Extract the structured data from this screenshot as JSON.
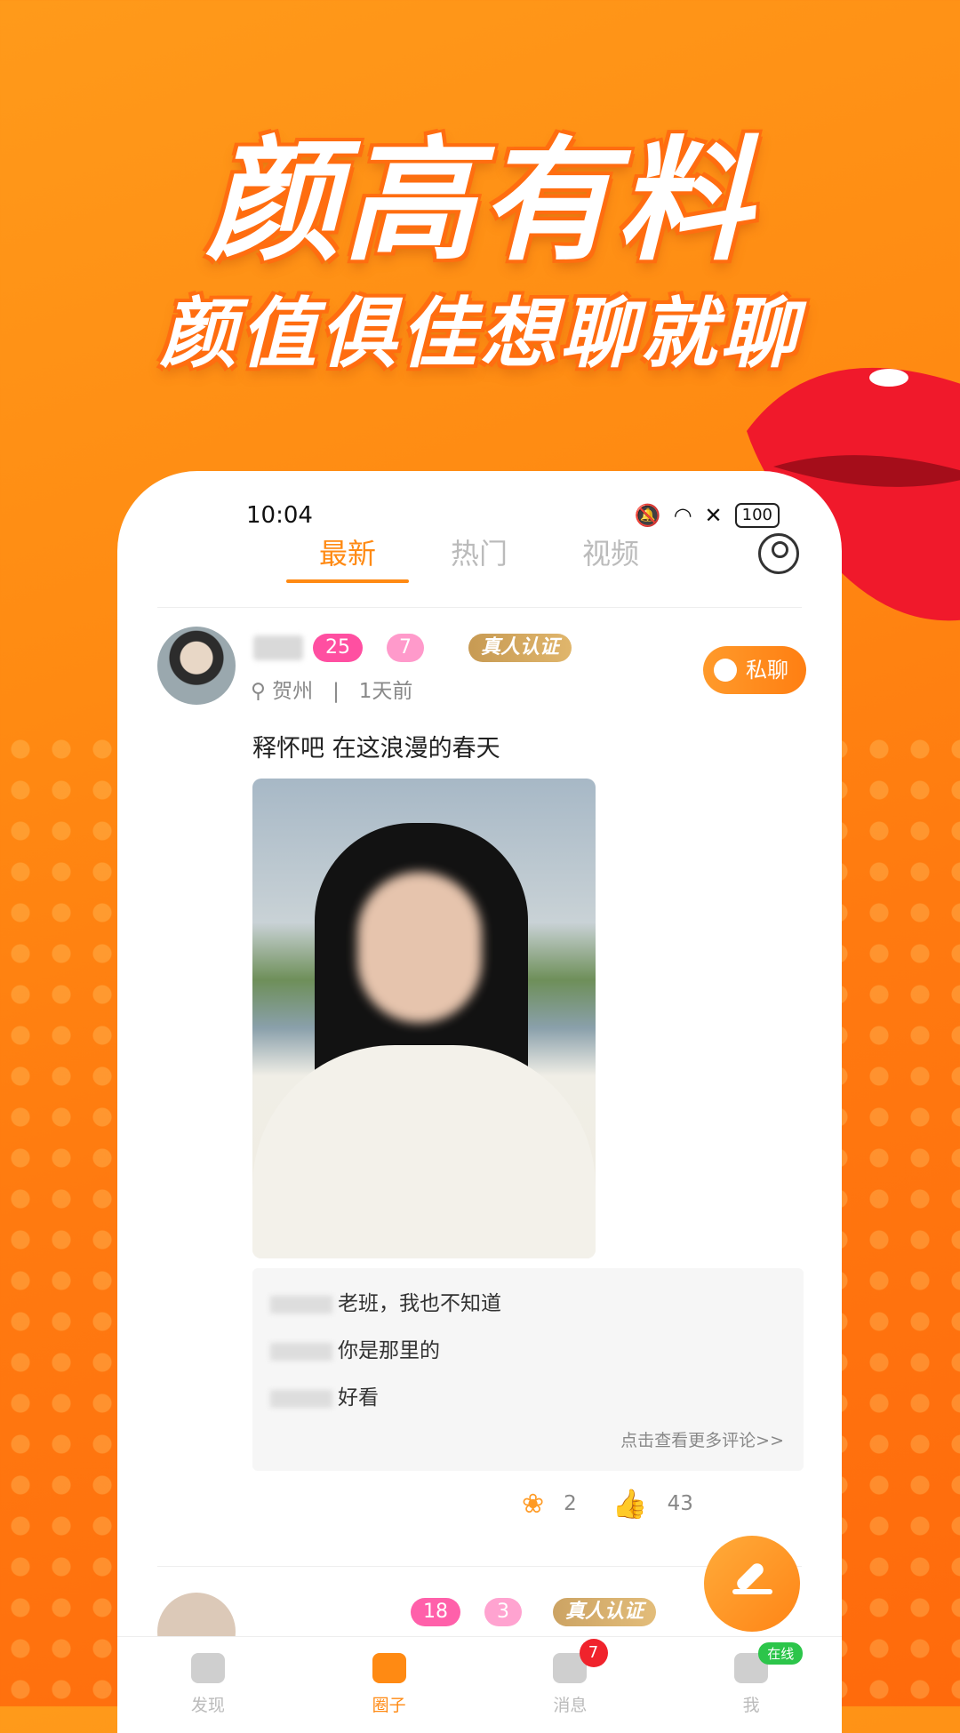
{
  "promo": {
    "title": "颜高有料",
    "subtitle": "颜值俱佳想聊就聊"
  },
  "status_bar": {
    "time": "10:04",
    "battery": "100"
  },
  "tabs": [
    {
      "label": "最新"
    },
    {
      "label": "热门"
    },
    {
      "label": "视频"
    }
  ],
  "post": {
    "level_badge": "25",
    "heart_badge": "7",
    "verify_badge": "真人认证",
    "location": "贺州",
    "separator": "|",
    "time_ago": "1天前",
    "chat_label": "私聊",
    "text": "释怀吧 在这浪漫的春天",
    "comments": [
      {
        "text": "老班，我也不知道"
      },
      {
        "text": "你是那里的"
      },
      {
        "text": "好看"
      }
    ],
    "more_comments": "点击查看更多评论>>",
    "flower_count": "2",
    "like_count": "43"
  },
  "post2": {
    "level_badge": "18",
    "heart_badge": "3",
    "verify_badge": "真人认证"
  },
  "nav": [
    {
      "label": "发现"
    },
    {
      "label": "圈子"
    },
    {
      "label": "消息",
      "badge": "7"
    },
    {
      "label": "我",
      "status": "在线"
    }
  ],
  "colors": {
    "accent": "#ff8a13",
    "badge_pink": "#ff4fa1",
    "badge_gold": "#c79a53",
    "notification_red": "#f0232c",
    "online_green": "#2cc54a"
  }
}
